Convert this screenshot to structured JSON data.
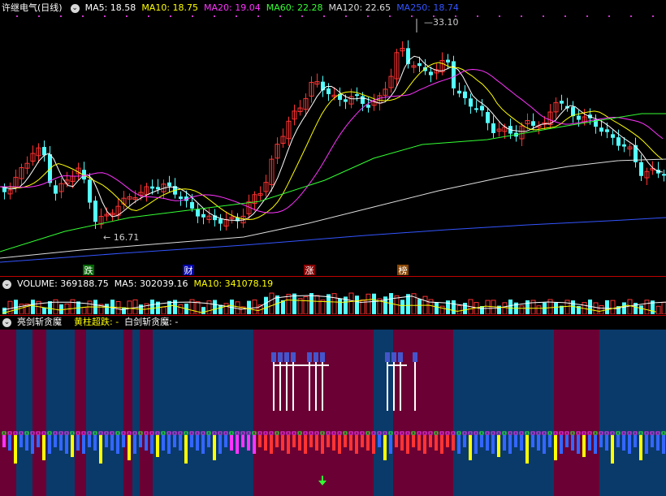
{
  "header": {
    "stock_name": "许继电气(日线)",
    "indicators": [
      {
        "label": "MA5: 18.58",
        "color": "#ffffff"
      },
      {
        "label": "MA10: 18.75",
        "color": "#ffff00"
      },
      {
        "label": "MA20: 19.04",
        "color": "#ff33ff"
      },
      {
        "label": "MA60: 22.28",
        "color": "#33ff33"
      },
      {
        "label": "MA120: 22.65",
        "color": "#dddddd"
      },
      {
        "label": "MA250: 18.74",
        "color": "#3355ff"
      }
    ]
  },
  "annotations": {
    "high": "33.10",
    "low": "16.71"
  },
  "markers": [
    {
      "text": "跌",
      "bg": "#006600",
      "fg": "#ffffff"
    },
    {
      "text": "财",
      "bg": "#0000aa",
      "fg": "#ffffff"
    },
    {
      "text": "涨",
      "bg": "#880000",
      "fg": "#ffffff"
    },
    {
      "text": "榜",
      "bg": "#884400",
      "fg": "#ffffff"
    }
  ],
  "volume_header": {
    "volume": "VOLUME: 369188.75",
    "ma5": "MA5: 302039.16",
    "ma10": "MA10: 341078.19"
  },
  "indicator_header": {
    "name": "亮剑斩贪魔",
    "line1": "黄柱超跌: -",
    "line2": "白剑斩贪魔: -"
  },
  "colors": {
    "up": "#ff3232",
    "down": "#54ffff",
    "ma5": "#ffffff",
    "ma10": "#ffff00",
    "ma20": "#ff33ff",
    "ma60": "#33ff33",
    "ma120": "#dddddd",
    "ma250": "#3355ff",
    "zone_red": "#6a0033",
    "zone_blue": "#0a3a6a"
  },
  "icons": [
    "dropdown-circle-icon",
    "arrow-down-icon"
  ]
}
